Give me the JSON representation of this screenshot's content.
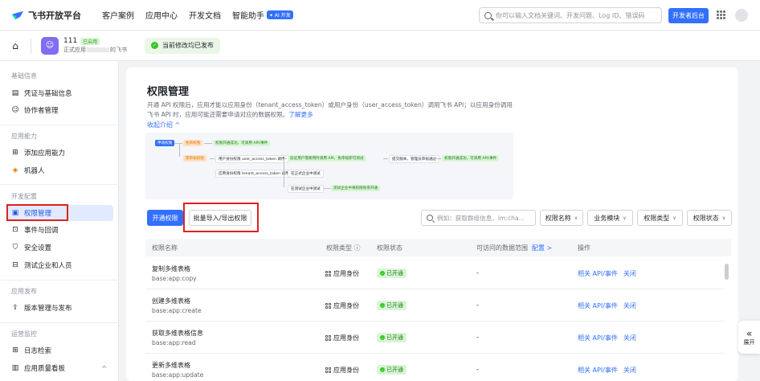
{
  "header": {
    "brand": "飞书开放平台",
    "nav": [
      "客户案例",
      "应用中心",
      "开发文档",
      "智能助手"
    ],
    "ai_badge": "✦ AI 开发",
    "search_placeholder": "你可以输入文档关键词、开发问题、Log ID、错误码",
    "dev_console": "开发者后台"
  },
  "appbar": {
    "app_name": "111",
    "app_status": "已启用",
    "app_sub_prefix": "正式应用",
    "app_sub_suffix": "的飞书",
    "publish_status": "当前修改均已发布"
  },
  "sidebar": {
    "sections": [
      {
        "title": "基础信息",
        "items": [
          "凭证与基础信息",
          "协作者管理"
        ]
      },
      {
        "title": "应用能力",
        "items": [
          "添加应用能力",
          "机器人"
        ]
      },
      {
        "title": "开发配置",
        "items": [
          "权限管理",
          "事件与回调",
          "安全设置",
          "测试企业和人员"
        ]
      },
      {
        "title": "应用发布",
        "items": [
          "版本管理与发布"
        ]
      },
      {
        "title": "运营监控",
        "items": [
          "日志检索",
          "应用质量看板"
        ]
      }
    ]
  },
  "main": {
    "title": "权限管理",
    "description": "开通 API 权限后，应用才能以应用身份（tenant_access_token）或用户身份（user_access_token）调用飞书 API；以应用身份调用飞书 API 时，应用可能还需要申请对应的数据权限。",
    "learn_more": "了解更多",
    "collapse": "收起介绍 ^",
    "diagram": {
      "apply": "申请权限",
      "no_review": "免审权限",
      "review": "需审核权限",
      "ok1": "权限开通成功，可调用 API/事件",
      "user_identity": "用户身份权限 user_access_token 调用",
      "test_enterprise": "验证用户需要用时调用 API，免审核即可测试",
      "submit": "提交版本，管理员审核通过",
      "ok2": "权限开通成功，可调用 API/事件",
      "app_identity": "应用身份权限 tenant_access_token 调用",
      "formal": "在正式企业中调试",
      "test": "在测试企业中调试",
      "test_ok": "测试企业中将权限免审开通"
    },
    "btn_enable": "开通权限",
    "btn_batch": "批量导入/导出权限",
    "table_search_placeholder": "例如：获取群组信息、im:cha...",
    "filters": [
      "权限名称",
      "业务模块",
      "权限类型",
      "权限状态"
    ],
    "columns": [
      "权限名称",
      "权限类型 ⓘ",
      "权限状态",
      "可访问的数据范围",
      "配置 >",
      "操作"
    ],
    "rows": [
      {
        "name": "复制多维表格",
        "code": "base:app:copy",
        "type": "应用身份",
        "status": "已开通",
        "range": "-",
        "op1": "相关 API/事件",
        "op2": "关闭"
      },
      {
        "name": "创建多维表格",
        "code": "base:app:create",
        "type": "应用身份",
        "status": "已开通",
        "range": "-",
        "op1": "相关 API/事件",
        "op2": "关闭"
      },
      {
        "name": "获取多维表格信息",
        "code": "base:app:read",
        "type": "应用身份",
        "status": "已开通",
        "range": "-",
        "op1": "相关 API/事件",
        "op2": "关闭"
      },
      {
        "name": "更新多维表格",
        "code": "base:app:update",
        "type": "应用身份",
        "status": "已开通",
        "range": "-",
        "op1": "相关 API/事件",
        "op2": "关闭"
      }
    ],
    "expand": "展开"
  },
  "colors": {
    "accent": "#3370ff",
    "highlight": "#e02020",
    "success": "#34c724"
  }
}
